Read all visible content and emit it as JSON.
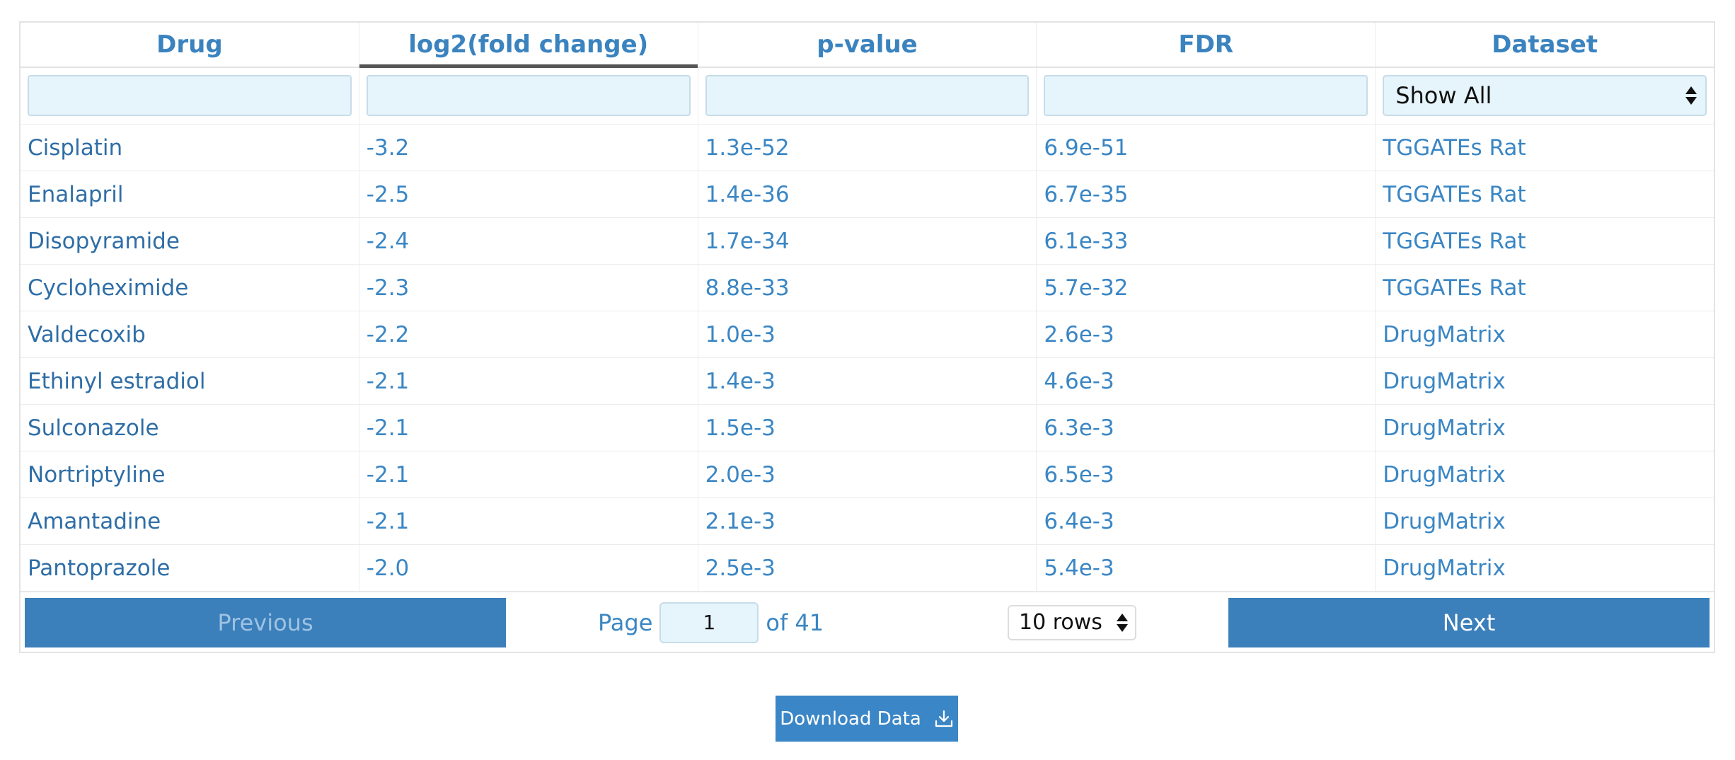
{
  "table": {
    "columns": [
      "Drug",
      "log2(fold change)",
      "p-value",
      "FDR",
      "Dataset"
    ],
    "sorted_column": "log2(fold change)",
    "dataset_filter": "Show All",
    "rows": [
      [
        "Cisplatin",
        "-3.2",
        "1.3e-52",
        "6.9e-51",
        "TGGATEs Rat"
      ],
      [
        "Enalapril",
        "-2.5",
        "1.4e-36",
        "6.7e-35",
        "TGGATEs Rat"
      ],
      [
        "Disopyramide",
        "-2.4",
        "1.7e-34",
        "6.1e-33",
        "TGGATEs Rat"
      ],
      [
        "Cycloheximide",
        "-2.3",
        "8.8e-33",
        "5.7e-32",
        "TGGATEs Rat"
      ],
      [
        "Valdecoxib",
        "-2.2",
        "1.0e-3",
        "2.6e-3",
        "DrugMatrix"
      ],
      [
        "Ethinyl estradiol",
        "-2.1",
        "1.4e-3",
        "4.6e-3",
        "DrugMatrix"
      ],
      [
        "Sulconazole",
        "-2.1",
        "1.5e-3",
        "6.3e-3",
        "DrugMatrix"
      ],
      [
        "Nortriptyline",
        "-2.1",
        "2.0e-3",
        "6.5e-3",
        "DrugMatrix"
      ],
      [
        "Amantadine",
        "-2.1",
        "2.1e-3",
        "6.4e-3",
        "DrugMatrix"
      ],
      [
        "Pantoprazole",
        "-2.0",
        "2.5e-3",
        "5.4e-3",
        "DrugMatrix"
      ]
    ]
  },
  "pagination": {
    "previous_label": "Previous",
    "next_label": "Next",
    "page_label": "Page",
    "current_page": "1",
    "of_label": "of 41",
    "rows_option": "10 rows"
  },
  "download": {
    "label": "Download Data",
    "icon": "download-icon"
  },
  "colors": {
    "accent": "#3b7fbb",
    "header_text": "#3a83bf",
    "input_bg": "#e6f4fb"
  }
}
